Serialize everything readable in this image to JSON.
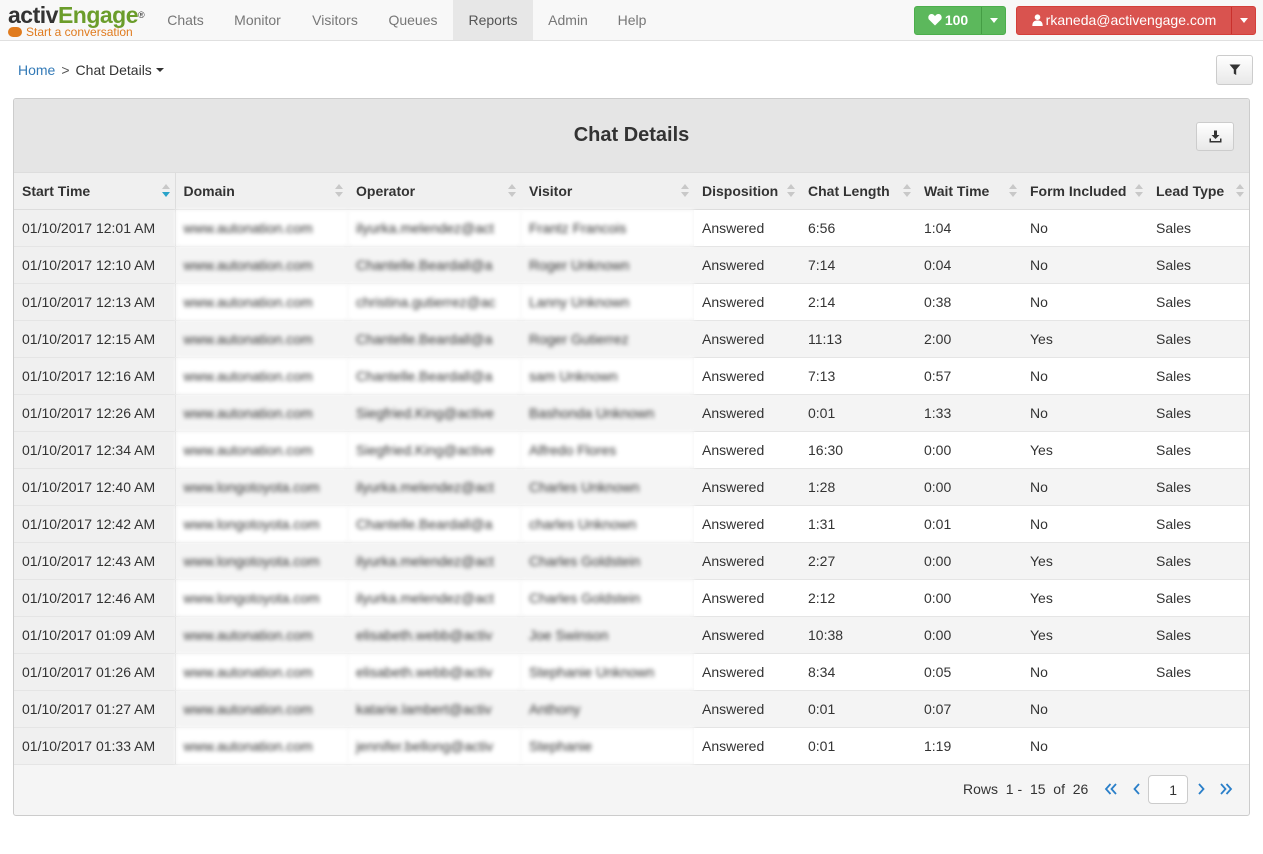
{
  "brand": {
    "name_part1": "activ",
    "name_part2": "Engage",
    "reg": "®",
    "tagline": "Start a conversation"
  },
  "nav": {
    "items": [
      {
        "label": "Chats"
      },
      {
        "label": "Monitor"
      },
      {
        "label": "Visitors"
      },
      {
        "label": "Queues"
      },
      {
        "label": "Reports",
        "active": true
      },
      {
        "label": "Admin"
      },
      {
        "label": "Help"
      }
    ],
    "likes_count": "100",
    "user_email": "rkaneda@activengage.com"
  },
  "breadcrumb": {
    "home": "Home",
    "separator": ">",
    "current": "Chat Details"
  },
  "panel": {
    "title": "Chat Details"
  },
  "table": {
    "columns": [
      "Start Time",
      "Domain",
      "Operator",
      "Visitor",
      "Disposition",
      "Chat Length",
      "Wait Time",
      "Form Included",
      "Lead Type"
    ],
    "sorted_column": "Start Time",
    "rows": [
      [
        "01/10/2017 12:01 AM",
        "www.autonation.com",
        "ilyurka.melendez@act",
        "Frantz Francois",
        "Answered",
        "6:56",
        "1:04",
        "No",
        "Sales"
      ],
      [
        "01/10/2017 12:10 AM",
        "www.autonation.com",
        "Chantelle.Beardall@a",
        "Roger Unknown",
        "Answered",
        "7:14",
        "0:04",
        "No",
        "Sales"
      ],
      [
        "01/10/2017 12:13 AM",
        "www.autonation.com",
        "christina.gutierrez@ac",
        "Lanny Unknown",
        "Answered",
        "2:14",
        "0:38",
        "No",
        "Sales"
      ],
      [
        "01/10/2017 12:15 AM",
        "www.autonation.com",
        "Chantelle.Beardall@a",
        "Roger Gutierrez",
        "Answered",
        "11:13",
        "2:00",
        "Yes",
        "Sales"
      ],
      [
        "01/10/2017 12:16 AM",
        "www.autonation.com",
        "Chantelle.Beardall@a",
        "sam Unknown",
        "Answered",
        "7:13",
        "0:57",
        "No",
        "Sales"
      ],
      [
        "01/10/2017 12:26 AM",
        "www.autonation.com",
        "Siegfried.King@active",
        "Bashonda Unknown",
        "Answered",
        "0:01",
        "1:33",
        "No",
        "Sales"
      ],
      [
        "01/10/2017 12:34 AM",
        "www.autonation.com",
        "Siegfried.King@active",
        "Alfredo Flores",
        "Answered",
        "16:30",
        "0:00",
        "Yes",
        "Sales"
      ],
      [
        "01/10/2017 12:40 AM",
        "www.longotoyota.com",
        "ilyurka.melendez@act",
        "Charles Unknown",
        "Answered",
        "1:28",
        "0:00",
        "No",
        "Sales"
      ],
      [
        "01/10/2017 12:42 AM",
        "www.longotoyota.com",
        "Chantelle.Beardall@a",
        "charles Unknown",
        "Answered",
        "1:31",
        "0:01",
        "No",
        "Sales"
      ],
      [
        "01/10/2017 12:43 AM",
        "www.longotoyota.com",
        "ilyurka.melendez@act",
        "Charles Goldstein",
        "Answered",
        "2:27",
        "0:00",
        "Yes",
        "Sales"
      ],
      [
        "01/10/2017 12:46 AM",
        "www.longotoyota.com",
        "ilyurka.melendez@act",
        "Charles Goldstein",
        "Answered",
        "2:12",
        "0:00",
        "Yes",
        "Sales"
      ],
      [
        "01/10/2017 01:09 AM",
        "www.autonation.com",
        "elisabeth.webb@activ",
        "Joe Swinson",
        "Answered",
        "10:38",
        "0:00",
        "Yes",
        "Sales"
      ],
      [
        "01/10/2017 01:26 AM",
        "www.autonation.com",
        "elisabeth.webb@activ",
        "Stephanie Unknown",
        "Answered",
        "8:34",
        "0:05",
        "No",
        "Sales"
      ],
      [
        "01/10/2017 01:27 AM",
        "www.autonation.com",
        "katarie.lambert@activ",
        "Anthony",
        "Answered",
        "0:01",
        "0:07",
        "No",
        ""
      ],
      [
        "01/10/2017 01:33 AM",
        "www.autonation.com",
        "jennifer.bellong@activ",
        "Stephanie",
        "Answered",
        "0:01",
        "1:19",
        "No",
        ""
      ]
    ]
  },
  "pager": {
    "rows_label": "Rows",
    "range_start": "1",
    "range_dash": "-",
    "range_end": "15",
    "of_label": "of",
    "total": "26",
    "current_page": "1"
  },
  "colors": {
    "brand_green": "#6b9d2b",
    "brand_orange": "#e07b1e",
    "like_button": "#5cb85c",
    "user_button": "#d9534f",
    "link": "#337ab7",
    "sort_active": "#2aa3c9"
  }
}
